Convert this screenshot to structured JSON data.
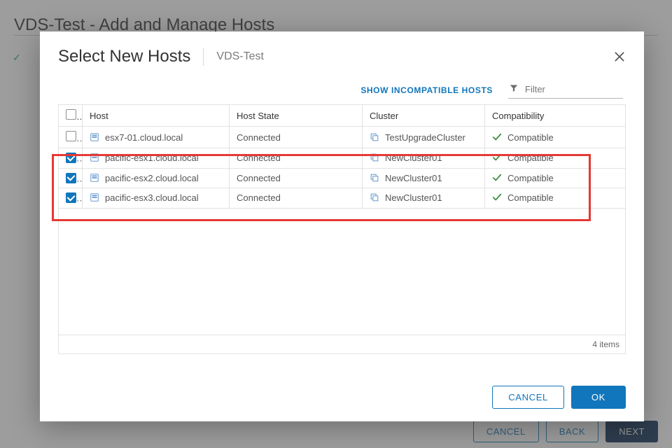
{
  "page": {
    "header": "VDS-Test - Add and Manage Hosts",
    "footer": {
      "cancel": "CANCEL",
      "back": "BACK",
      "next": "NEXT"
    }
  },
  "modal": {
    "title": "Select New Hosts",
    "context": "VDS-Test",
    "show_incompatible": "SHOW INCOMPATIBLE HOSTS",
    "filter_placeholder": "Filter",
    "columns": {
      "host": "Host",
      "state": "Host State",
      "cluster": "Cluster",
      "compat": "Compatibility"
    },
    "rows": [
      {
        "checked": false,
        "host": "esx7-01.cloud.local",
        "state": "Connected",
        "cluster": "TestUpgradeCluster",
        "compat": "Compatible"
      },
      {
        "checked": true,
        "host": "pacific-esx1.cloud.local",
        "state": "Connected",
        "cluster": "NewCluster01",
        "compat": "Compatible"
      },
      {
        "checked": true,
        "host": "pacific-esx2.cloud.local",
        "state": "Connected",
        "cluster": "NewCluster01",
        "compat": "Compatible"
      },
      {
        "checked": true,
        "host": "pacific-esx3.cloud.local",
        "state": "Connected",
        "cluster": "NewCluster01",
        "compat": "Compatible"
      }
    ],
    "items_count": "4 items",
    "buttons": {
      "cancel": "CANCEL",
      "ok": "OK"
    }
  }
}
